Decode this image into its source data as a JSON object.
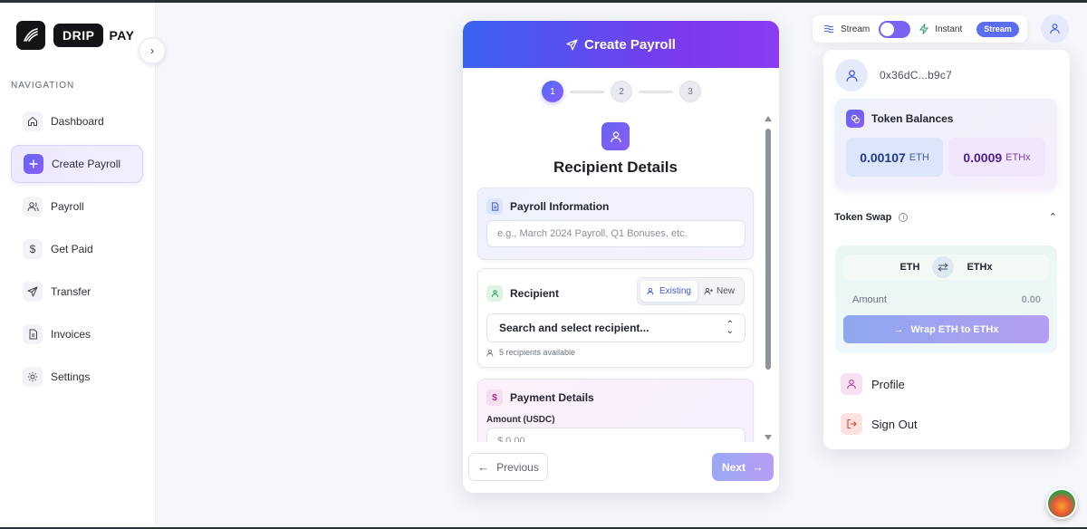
{
  "brand": {
    "word1": "DRIP",
    "word2": "PAY"
  },
  "sidebar": {
    "heading": "NAVIGATION",
    "items": [
      {
        "label": "Dashboard",
        "icon": "home-icon"
      },
      {
        "label": "Create Payroll",
        "icon": "plus-icon",
        "active": true
      },
      {
        "label": "Payroll",
        "icon": "users-icon"
      },
      {
        "label": "Get Paid",
        "icon": "dollar-icon"
      },
      {
        "label": "Transfer",
        "icon": "send-icon"
      },
      {
        "label": "Invoices",
        "icon": "document-icon"
      },
      {
        "label": "Settings",
        "icon": "gear-icon"
      }
    ]
  },
  "card": {
    "title": "Create Payroll",
    "steps": [
      "1",
      "2",
      "3"
    ],
    "current_step": 1,
    "section_title": "Recipient Details",
    "payroll_info": {
      "label": "Payroll Information",
      "placeholder": "e.g., March 2024 Payroll, Q1 Bonuses, etc."
    },
    "recipient": {
      "label": "Recipient",
      "tab_existing": "Existing",
      "tab_new": "New",
      "select_text": "Search and select recipient...",
      "hint": "5 recipients available"
    },
    "payment": {
      "label": "Payment Details",
      "amount_label": "Amount (USDC)",
      "amount_placeholder": "$   0.00"
    },
    "prev_label": "Previous",
    "next_label": "Next"
  },
  "mode": {
    "stream_label": "Stream",
    "instant_label": "Instant",
    "badge": "Stream"
  },
  "account": {
    "address": "0x36dC...b9c7",
    "balances_title": "Token Balances",
    "eth_value": "0.00107",
    "eth_unit": "ETH",
    "ethx_value": "0.0009",
    "ethx_unit": "ETHx",
    "swap_title": "Token Swap",
    "swap_from": "ETH",
    "swap_to": "ETHx",
    "amount_label": "Amount",
    "amount_value": "0.00",
    "wrap_label": "Wrap ETH to ETHx",
    "profile_label": "Profile",
    "signout_label": "Sign Out"
  },
  "colors": {
    "accent": "#6366f1",
    "accent2": "#8b5cf6",
    "header_gradient_start": "#3b63f0",
    "header_gradient_end": "#8b3cf0"
  }
}
